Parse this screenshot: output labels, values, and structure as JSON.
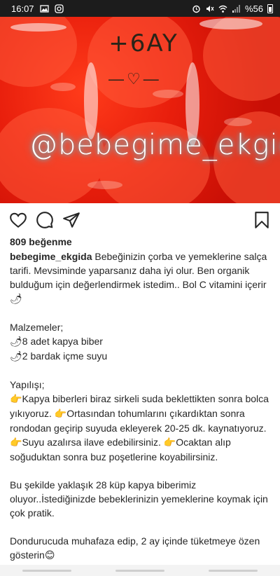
{
  "status_bar": {
    "time": "16:07",
    "battery": "%56",
    "icons": [
      "image-icon",
      "instagram-icon",
      "alarm-icon",
      "mute-icon",
      "wifi-icon",
      "signal-icon",
      "battery-icon"
    ]
  },
  "photo": {
    "overlay_top": "+6AY",
    "overlay_heart": "—♡—",
    "overlay_handle": "@bebegime_ekgida"
  },
  "actions": {
    "icons": [
      "heart-icon",
      "comment-icon",
      "share-icon",
      "bookmark-icon"
    ]
  },
  "likes_text": "809 beğenme",
  "caption": {
    "username": "bebegime_ekgida",
    "intro": " Bebeğinizin çorba ve yemeklerine salça tarifi. Mevsiminde yaparsanız daha iyi olur. Ben organik bulduğum için değerlendirmek istedim.. Bol C vitamini içerir",
    "ingredients_title": "Malzemeler;",
    "ingredient_1": "8 adet kapya biber",
    "ingredient_2": "2 bardak içme suyu",
    "method_title": "Yapılışı;",
    "step_1": "Kapya biberleri biraz sirkeli suda beklettikten sonra bolca yıkıyoruz. ",
    "step_2": "Ortasından tohumlarını çıkardıktan sonra rondodan geçirip suyuda ekleyerek 20-25 dk. kaynatıyoruz. ",
    "step_3": "Suyu azalırsa ilave edebilirsiniz. ",
    "step_4": "Ocaktan alıp soğuduktan sonra buz poşetlerine koyabilirsiniz.",
    "note": "Bu şekilde yaklaşık 28 küp kapya biberimiz oluyor..İstediğinizde bebeklerinizin yemeklerine koymak için çok pratik.",
    "storage": "Dondurucuda muhafaza edip, 2 ay içinde tüketmeye özen gösterin"
  },
  "emoji": {
    "pepper": "🌶",
    "point": "👉",
    "smile": "😊"
  }
}
